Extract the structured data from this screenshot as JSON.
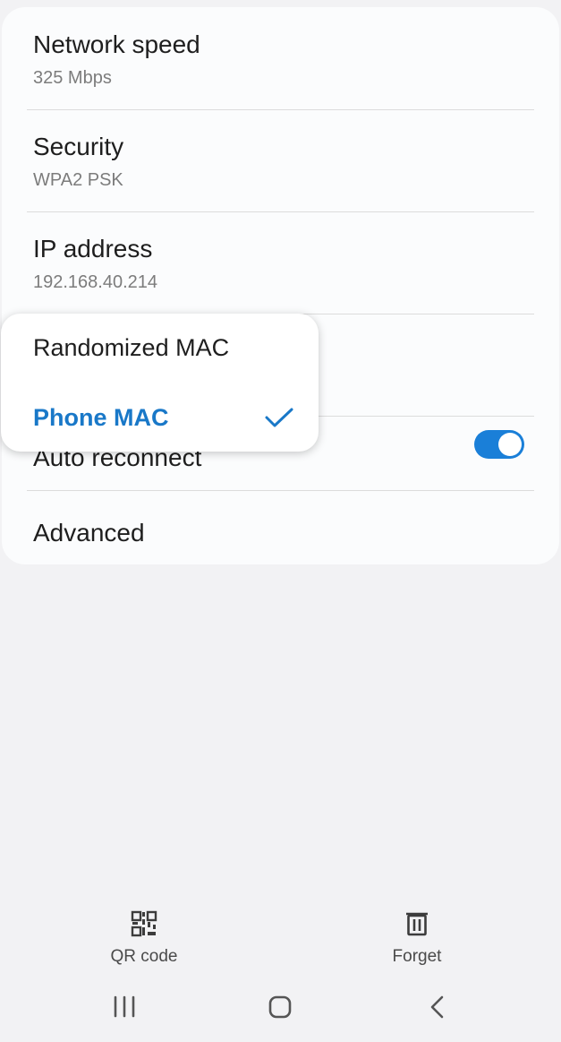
{
  "settings": {
    "network_speed": {
      "title": "Network speed",
      "value": "325 Mbps"
    },
    "security": {
      "title": "Security",
      "value": "WPA2 PSK"
    },
    "ip_address": {
      "title": "IP address",
      "value": "192.168.40.214"
    },
    "auto_reconnect": {
      "title": "Auto reconnect",
      "enabled": true
    },
    "advanced": {
      "title": "Advanced"
    }
  },
  "mac_popup": {
    "options": [
      {
        "label": "Randomized MAC",
        "selected": false
      },
      {
        "label": "Phone MAC",
        "selected": true
      }
    ]
  },
  "bottom_actions": {
    "qr_code": {
      "label": "QR code",
      "icon": "qr-code-icon"
    },
    "forget": {
      "label": "Forget",
      "icon": "trash-icon"
    }
  },
  "colors": {
    "accent": "#1978c8",
    "toggle_on": "#1a7fd8",
    "background": "#f2f2f4",
    "card": "#fbfcfd"
  }
}
